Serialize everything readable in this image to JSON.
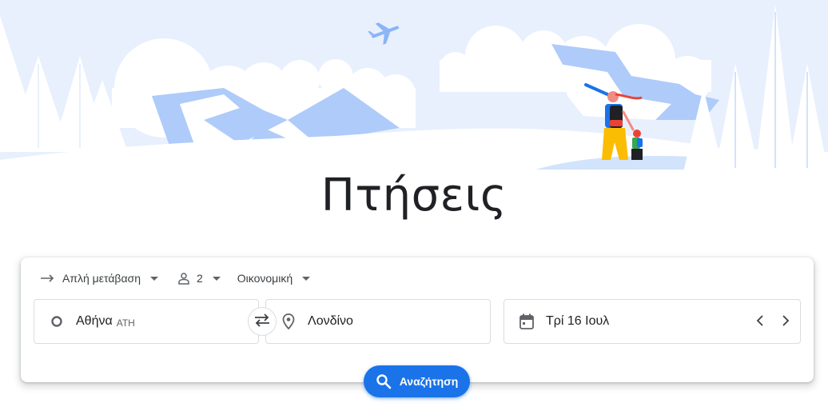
{
  "hero": {
    "title": "Πτήσεις",
    "colors": {
      "sky": "#e8f0fe",
      "mountain": "#aecbfa",
      "snow": "#ffffff",
      "plane": "#8ab4f8"
    }
  },
  "search": {
    "trip_type": {
      "label": "Απλή μετάβαση",
      "icon": "arrow-right-icon"
    },
    "passengers": {
      "count": "2",
      "icon": "person-icon"
    },
    "cabin_class": {
      "label": "Οικονομική"
    },
    "origin": {
      "city": "Αθήνα",
      "code": "ATH",
      "icon": "circle-icon"
    },
    "destination": {
      "city": "Λονδίνο",
      "icon": "location-pin-icon"
    },
    "swap": {
      "icon": "swap-arrows-icon"
    },
    "date": {
      "label": "Τρί 16 Ιουλ",
      "icon": "calendar-icon"
    },
    "submit": {
      "label": "Αναζήτηση",
      "icon": "search-icon",
      "color": "#1a73e8"
    }
  }
}
